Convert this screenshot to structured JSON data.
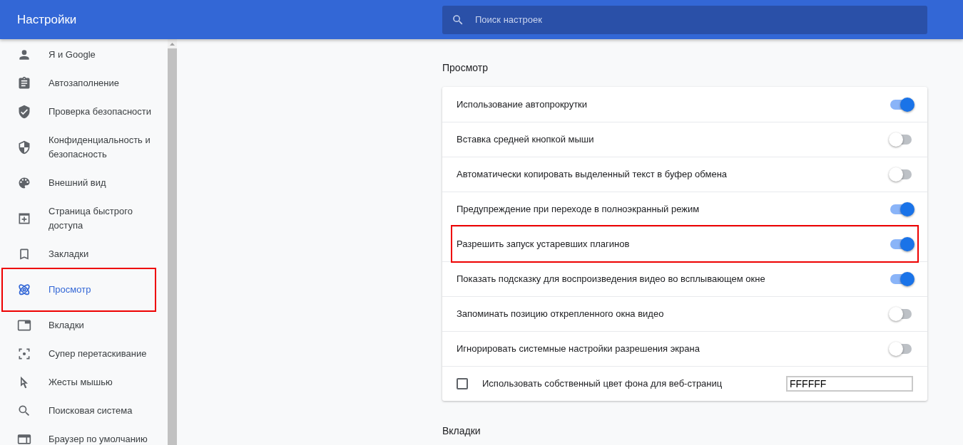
{
  "header": {
    "title": "Настройки",
    "search": {
      "placeholder": "Поиск настроек"
    }
  },
  "sidebar": {
    "items": [
      {
        "label": "Я и Google",
        "selected": false,
        "highlighted": false
      },
      {
        "label": "Автозаполнение",
        "selected": false,
        "highlighted": false
      },
      {
        "label": "Проверка безопасности",
        "selected": false,
        "highlighted": false
      },
      {
        "label": "Конфиденциальность и безопасность",
        "selected": false,
        "highlighted": false
      },
      {
        "label": "Внешний вид",
        "selected": false,
        "highlighted": false
      },
      {
        "label": "Страница быстрого доступа",
        "selected": false,
        "highlighted": false
      },
      {
        "label": "Закладки",
        "selected": false,
        "highlighted": false
      },
      {
        "label": "Просмотр",
        "selected": true,
        "highlighted": true
      },
      {
        "label": "Вкладки",
        "selected": false,
        "highlighted": false
      },
      {
        "label": "Супер перетаскивание",
        "selected": false,
        "highlighted": false
      },
      {
        "label": "Жесты мышью",
        "selected": false,
        "highlighted": false
      },
      {
        "label": "Поисковая система",
        "selected": false,
        "highlighted": false
      },
      {
        "label": "Браузер по умолчанию",
        "selected": false,
        "highlighted": false
      }
    ]
  },
  "sections": [
    {
      "title": "Просмотр",
      "rows": [
        {
          "kind": "toggle",
          "label": "Использование автопрокрутки",
          "on": true,
          "highlighted": false
        },
        {
          "kind": "toggle",
          "label": "Вставка средней кнопкой мыши",
          "on": false,
          "highlighted": false
        },
        {
          "kind": "toggle",
          "label": "Автоматически копировать выделенный текст в буфер обмена",
          "on": false,
          "highlighted": false
        },
        {
          "kind": "toggle",
          "label": "Предупреждение при переходе в полноэкранный режим",
          "on": true,
          "highlighted": false
        },
        {
          "kind": "toggle",
          "label": "Разрешить запуск устаревших плагинов",
          "on": true,
          "highlighted": true
        },
        {
          "kind": "toggle",
          "label": "Показать подсказку для воспроизведения видео во всплывающем окне",
          "on": true,
          "highlighted": false
        },
        {
          "kind": "toggle",
          "label": "Запоминать позицию открепленного окна видео",
          "on": false,
          "highlighted": false
        },
        {
          "kind": "toggle",
          "label": "Игнорировать системные настройки разрешения экрана",
          "on": false,
          "highlighted": false
        },
        {
          "kind": "checkbox_input",
          "label": "Использовать собственный цвет фона для веб-страниц",
          "checked": false,
          "value": "FFFFFF",
          "highlighted": false
        }
      ]
    },
    {
      "title": "Вкладки"
    }
  ]
}
